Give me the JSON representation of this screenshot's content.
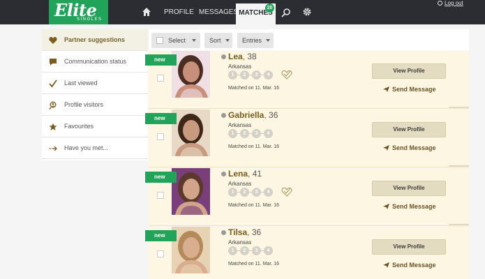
{
  "app": {
    "logo_text": "Elite",
    "logo_sub": "SINGLES"
  },
  "nav": {
    "home_icon": "home-icon",
    "profile": "PROFILE",
    "messages": "MESSAGES",
    "matches": "MATCHES",
    "matches_badge": "20",
    "search_icon": "search-icon",
    "settings_icon": "gear-icon",
    "logout": "Log out"
  },
  "sidebar": {
    "items": [
      {
        "label": "Partner suggestions",
        "icon": "heart-icon",
        "active": true
      },
      {
        "label": "Communication status",
        "icon": "speech-bubble-icon"
      },
      {
        "label": "Last viewed",
        "icon": "checkmark-icon"
      },
      {
        "label": "Profile visitors",
        "icon": "visitor-icon"
      },
      {
        "label": "Favourites",
        "icon": "star-icon"
      },
      {
        "label": "Have you met...",
        "icon": "arrow-dots-icon"
      }
    ]
  },
  "toolbar": {
    "select_label": "Select",
    "sort_label": "Sort",
    "entries_label": "Entries"
  },
  "matches": [
    {
      "tag": "new",
      "name": "Lea",
      "age": "38",
      "location": "Arkansas",
      "steps": [
        "1",
        "2",
        "3",
        "4"
      ],
      "matched": "Matched on 11. Mar. 16",
      "view_profile": "View Profile",
      "send_message": "Send Message"
    },
    {
      "tag": "new",
      "name": "Gabriella",
      "age": "36",
      "location": "Arkansas",
      "steps": [
        "1",
        "2",
        "3",
        "4"
      ],
      "matched": "Matched on 11. Mar. 16",
      "view_profile": "View Profile",
      "send_message": "Send Message"
    },
    {
      "tag": "new",
      "name": "Lena",
      "age": "41",
      "location": "Arkansas",
      "steps": [
        "1",
        "2",
        "3",
        "4"
      ],
      "matched": "Matched on 11. Mar. 16",
      "view_profile": "View Profile",
      "send_message": "Send Message"
    },
    {
      "tag": "new",
      "name": "Tilsa",
      "age": "36",
      "location": "Arkansas",
      "steps": [
        "1",
        "2",
        "3",
        "4"
      ],
      "matched": "Matched on 11. Mar. 16",
      "view_profile": "View Profile",
      "send_message": "Send Message"
    }
  ],
  "colors": {
    "brand_green": "#22a35a",
    "topbar": "#2b2d33",
    "card_bg": "#fdf6e2",
    "accent_brown": "#7a5d1c"
  }
}
